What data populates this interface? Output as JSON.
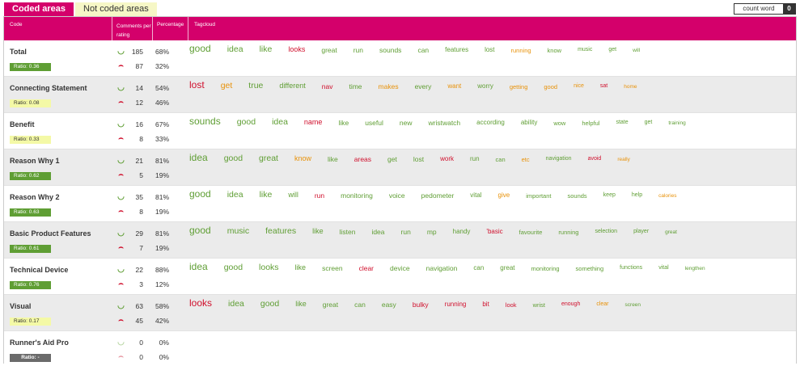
{
  "tabs": [
    {
      "label": "Coded areas",
      "active": true
    },
    {
      "label": "Not coded areas",
      "active": false
    }
  ],
  "count_word": {
    "label": "count word",
    "value": "0"
  },
  "header": {
    "code": "Code",
    "comments": "Comments per rating",
    "percentage": "Percentage",
    "tagcloud": "Tagcloud"
  },
  "icons": {
    "positive": "smile-icon",
    "negative": "frown-icon"
  },
  "colors": {
    "accent": "#d4006b",
    "positive": "#5f9e34",
    "negative": "#d0102d",
    "neutral": "#e8920a",
    "yellow_badge": "#f4f9a6"
  },
  "rows": [
    {
      "code": "Total",
      "ratio": "Ratio: 0.36",
      "ratio_style": "green",
      "pos": "185",
      "neg": "87",
      "pos_pct": "68%",
      "neg_pct": "32%",
      "tags": [
        [
          "good",
          "g"
        ],
        [
          "idea",
          "g"
        ],
        [
          "like",
          "g"
        ],
        [
          "looks",
          "r"
        ],
        [
          "great",
          "g"
        ],
        [
          "run",
          "g"
        ],
        [
          "sounds",
          "g"
        ],
        [
          "can",
          "g"
        ],
        [
          "features",
          "g"
        ],
        [
          "lost",
          "g"
        ],
        [
          "running",
          "o"
        ],
        [
          "know",
          "g"
        ],
        [
          "music",
          "g"
        ],
        [
          "get",
          "g"
        ],
        [
          "will",
          "g"
        ]
      ]
    },
    {
      "code": "Connecting Statement",
      "ratio": "Ratio: 0.08",
      "ratio_style": "yellow",
      "pos": "14",
      "neg": "12",
      "pos_pct": "54%",
      "neg_pct": "46%",
      "tags": [
        [
          "lost",
          "r"
        ],
        [
          "get",
          "o"
        ],
        [
          "true",
          "g"
        ],
        [
          "different",
          "g"
        ],
        [
          "nav",
          "r"
        ],
        [
          "time",
          "g"
        ],
        [
          "makes",
          "o"
        ],
        [
          "every",
          "g"
        ],
        [
          "want",
          "o"
        ],
        [
          "worry",
          "g"
        ],
        [
          "getting",
          "o"
        ],
        [
          "good",
          "o"
        ],
        [
          "nice",
          "o"
        ],
        [
          "sat",
          "r"
        ],
        [
          "home",
          "o"
        ]
      ]
    },
    {
      "code": "Benefit",
      "ratio": "Ratio: 0.33",
      "ratio_style": "yellow",
      "pos": "16",
      "neg": "8",
      "pos_pct": "67%",
      "neg_pct": "33%",
      "tags": [
        [
          "sounds",
          "g"
        ],
        [
          "good",
          "g"
        ],
        [
          "idea",
          "g"
        ],
        [
          "name",
          "r"
        ],
        [
          "like",
          "g"
        ],
        [
          "useful",
          "g"
        ],
        [
          "new",
          "g"
        ],
        [
          "wristwatch",
          "g"
        ],
        [
          "according",
          "g"
        ],
        [
          "ability",
          "g"
        ],
        [
          "wow",
          "g"
        ],
        [
          "helpful",
          "g"
        ],
        [
          "state",
          "g"
        ],
        [
          "get",
          "g"
        ],
        [
          "training",
          "g"
        ]
      ]
    },
    {
      "code": "Reason Why 1",
      "ratio": "Ratio: 0.62",
      "ratio_style": "green",
      "pos": "21",
      "neg": "5",
      "pos_pct": "81%",
      "neg_pct": "19%",
      "tags": [
        [
          "idea",
          "g"
        ],
        [
          "good",
          "g"
        ],
        [
          "great",
          "g"
        ],
        [
          "know",
          "o"
        ],
        [
          "like",
          "g"
        ],
        [
          "areas",
          "r"
        ],
        [
          "get",
          "g"
        ],
        [
          "lost",
          "g"
        ],
        [
          "work",
          "r"
        ],
        [
          "run",
          "g"
        ],
        [
          "can",
          "g"
        ],
        [
          "etc",
          "o"
        ],
        [
          "navigation",
          "g"
        ],
        [
          "avoid",
          "r"
        ],
        [
          "really",
          "o"
        ]
      ]
    },
    {
      "code": "Reason Why 2",
      "ratio": "Ratio: 0.63",
      "ratio_style": "green",
      "pos": "35",
      "neg": "8",
      "pos_pct": "81%",
      "neg_pct": "19%",
      "tags": [
        [
          "good",
          "g"
        ],
        [
          "idea",
          "g"
        ],
        [
          "like",
          "g"
        ],
        [
          "will",
          "g"
        ],
        [
          "run",
          "r"
        ],
        [
          "monitoring",
          "g"
        ],
        [
          "voice",
          "g"
        ],
        [
          "pedometer",
          "g"
        ],
        [
          "vital",
          "g"
        ],
        [
          "give",
          "o"
        ],
        [
          "important",
          "g"
        ],
        [
          "sounds",
          "g"
        ],
        [
          "keep",
          "g"
        ],
        [
          "help",
          "g"
        ],
        [
          "calories",
          "o"
        ]
      ]
    },
    {
      "code": "Basic Product Features",
      "ratio": "Ratio: 0.61",
      "ratio_style": "green",
      "pos": "29",
      "neg": "7",
      "pos_pct": "81%",
      "neg_pct": "19%",
      "tags": [
        [
          "good",
          "g"
        ],
        [
          "music",
          "g"
        ],
        [
          "features",
          "g"
        ],
        [
          "like",
          "g"
        ],
        [
          "listen",
          "g"
        ],
        [
          "idea",
          "g"
        ],
        [
          "run",
          "g"
        ],
        [
          "mp",
          "g"
        ],
        [
          "handy",
          "g"
        ],
        [
          "'basic",
          "r"
        ],
        [
          "favourite",
          "g"
        ],
        [
          "running",
          "g"
        ],
        [
          "selection",
          "g"
        ],
        [
          "player",
          "g"
        ],
        [
          "great",
          "g"
        ]
      ]
    },
    {
      "code": "Technical Device",
      "ratio": "Ratio: 0.76",
      "ratio_style": "green",
      "pos": "22",
      "neg": "3",
      "pos_pct": "88%",
      "neg_pct": "12%",
      "tags": [
        [
          "idea",
          "g"
        ],
        [
          "good",
          "g"
        ],
        [
          "looks",
          "g"
        ],
        [
          "like",
          "g"
        ],
        [
          "screen",
          "g"
        ],
        [
          "clear",
          "r"
        ],
        [
          "device",
          "g"
        ],
        [
          "navigation",
          "g"
        ],
        [
          "can",
          "g"
        ],
        [
          "great",
          "g"
        ],
        [
          "monitoring",
          "g"
        ],
        [
          "something",
          "g"
        ],
        [
          "functions",
          "g"
        ],
        [
          "vital",
          "g"
        ],
        [
          "lengthen",
          "g"
        ]
      ]
    },
    {
      "code": "Visual",
      "ratio": "Ratio: 0.17",
      "ratio_style": "yellow",
      "pos": "63",
      "neg": "45",
      "pos_pct": "58%",
      "neg_pct": "42%",
      "tags": [
        [
          "looks",
          "r"
        ],
        [
          "idea",
          "g"
        ],
        [
          "good",
          "g"
        ],
        [
          "like",
          "g"
        ],
        [
          "great",
          "g"
        ],
        [
          "can",
          "g"
        ],
        [
          "easy",
          "g"
        ],
        [
          "bulky",
          "r"
        ],
        [
          "running",
          "r"
        ],
        [
          "bit",
          "r"
        ],
        [
          "look",
          "r"
        ],
        [
          "wrist",
          "g"
        ],
        [
          "enough",
          "r"
        ],
        [
          "clear",
          "o"
        ],
        [
          "screen",
          "g"
        ]
      ]
    },
    {
      "code": "Runner's Aid Pro",
      "ratio": "Ratio: -",
      "ratio_style": "grey",
      "pos": "0",
      "neg": "0",
      "pos_pct": "0%",
      "neg_pct": "0%",
      "tags": []
    }
  ]
}
